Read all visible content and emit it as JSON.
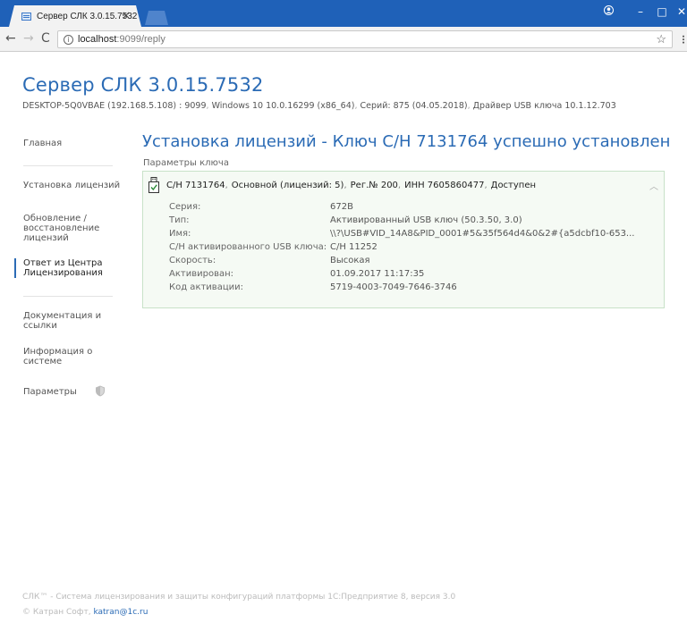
{
  "browser": {
    "tab_title": "Сервер СЛК 3.0.15.7532",
    "url_host": "localhost",
    "url_path": ":9099/reply",
    "theme_color": "#1f61b8"
  },
  "header": {
    "title": "Сервер СЛК 3.0.15.7532",
    "host": "DESKTOP-5Q0VBAE (192.168.5.108) : 9099",
    "os": "Windows 10 10.0.16299 (x86_64)",
    "series": "Серий: 875 (04.05.2018)",
    "driver": "Драйвер USB ключа 10.1.12.703"
  },
  "sidebar": {
    "items": [
      {
        "label": "Главная"
      },
      {
        "label": "Установка лицензий"
      },
      {
        "label": "Обновление / восстановление лицензий"
      },
      {
        "label": "Ответ из Центра Лицензирования"
      },
      {
        "label": "Документация и ссылки"
      },
      {
        "label": "Информация о системе"
      },
      {
        "label": "Параметры"
      }
    ]
  },
  "main": {
    "title": "Установка лицензий - Ключ С/Н 7131764 успешно установлен",
    "params_label": "Параметры ключа",
    "card": {
      "serial": "С/Н 7131764",
      "kind": "Основной (лицензий: 5)",
      "reg": "Рег.№ 200",
      "inn": "ИНН 7605860477",
      "status": "Доступен",
      "rows": [
        {
          "key": "Серия:",
          "value": "672B"
        },
        {
          "key": "Тип:",
          "value": "Активированный USB ключ (50.3.50, 3.0)"
        },
        {
          "key": "Имя:",
          "value": "\\\\?\\USB#VID_14A8&PID_0001#5&35f564d4&0&2#{a5dcbf10-653..."
        },
        {
          "key": "С/Н активированного USB ключа:",
          "value": "С/Н 11252"
        },
        {
          "key": "Скорость:",
          "value": "Высокая"
        },
        {
          "key": "Активирован:",
          "value": "01.09.2017 11:17:35"
        },
        {
          "key": "Код активации:",
          "value": "5719-4003-7049-7646-3746"
        }
      ]
    }
  },
  "footer": {
    "line1": "СЛК™ - Система лицензирования и защиты конфигураций платформы 1С:Предприятие 8, версия 3.0",
    "copyright": "© Катран Софт,",
    "email": "katran@1c.ru"
  }
}
